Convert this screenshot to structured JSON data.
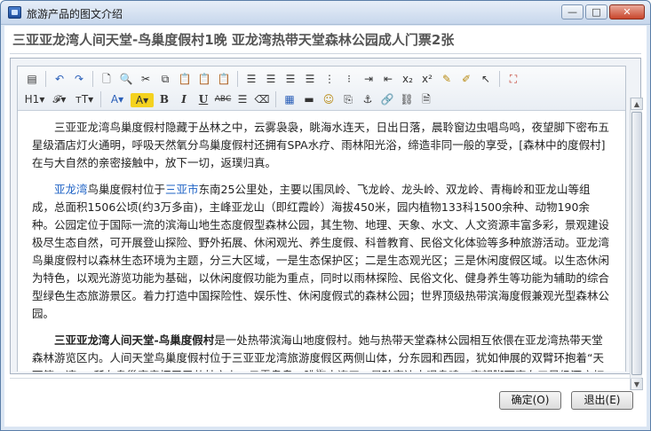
{
  "window": {
    "title": "旅游产品的图文介绍",
    "minimize_glyph": "—",
    "maximize_glyph": "□",
    "close_glyph": "✕"
  },
  "product_title": "三亚亚龙湾人间天堂-鸟巢度假村1晚 亚龙湾热带天堂森林公园成人门票2张",
  "toolbar": {
    "row1": [
      {
        "name": "source-icon",
        "glyph": "▤"
      },
      {
        "sep": true
      },
      {
        "name": "undo-icon",
        "glyph": "↶"
      },
      {
        "name": "redo-icon",
        "glyph": "↷"
      },
      {
        "sep": true
      },
      {
        "name": "new-document-icon",
        "glyph": "🗋"
      },
      {
        "name": "preview-icon",
        "glyph": "🔍"
      },
      {
        "name": "cut-icon",
        "glyph": "✂"
      },
      {
        "name": "copy-icon",
        "glyph": "⧉"
      },
      {
        "name": "paste-icon",
        "glyph": "📋"
      },
      {
        "name": "paste-text-icon",
        "glyph": "📋"
      },
      {
        "name": "paste-word-icon",
        "glyph": "📋"
      },
      {
        "sep": true
      },
      {
        "name": "align-left-icon",
        "glyph": "☰"
      },
      {
        "name": "align-center-icon",
        "glyph": "☰"
      },
      {
        "name": "align-right-icon",
        "glyph": "☰"
      },
      {
        "name": "align-justify-icon",
        "glyph": "☰"
      },
      {
        "name": "ordered-list-icon",
        "glyph": "⋮"
      },
      {
        "name": "unordered-list-icon",
        "glyph": "⁝"
      },
      {
        "name": "indent-icon",
        "glyph": "⇥"
      },
      {
        "name": "outdent-icon",
        "glyph": "⇤"
      },
      {
        "name": "subscript-icon",
        "glyph": "x₂"
      },
      {
        "name": "superscript-icon",
        "glyph": "x²"
      },
      {
        "name": "clear-format-icon",
        "glyph": "✎"
      },
      {
        "name": "format-brush-icon",
        "glyph": "✐"
      },
      {
        "name": "select-all-icon",
        "glyph": "↖"
      },
      {
        "sep": true
      },
      {
        "name": "fullscreen-icon",
        "glyph": "⛶"
      }
    ],
    "row2": [
      {
        "name": "heading-dropdown",
        "glyph": "H1▾",
        "wide": true
      },
      {
        "name": "font-family-dropdown",
        "glyph": "𝓕▾",
        "wide": true
      },
      {
        "name": "font-size-dropdown",
        "glyph": "тT▾",
        "wide": true
      },
      {
        "sep": true
      },
      {
        "name": "font-color-icon",
        "glyph": "A▾",
        "wide": true
      },
      {
        "name": "highlight-color-icon",
        "glyph": "A▾",
        "wide": true
      },
      {
        "name": "bold-icon",
        "glyph": "B"
      },
      {
        "name": "italic-icon",
        "glyph": "I"
      },
      {
        "name": "underline-icon",
        "glyph": "U"
      },
      {
        "name": "strikethrough-icon",
        "glyph": "ABC"
      },
      {
        "name": "line-height-icon",
        "glyph": "☰"
      },
      {
        "name": "remove-format-icon",
        "glyph": "⌫"
      },
      {
        "sep": true
      },
      {
        "name": "table-icon",
        "glyph": "▦"
      },
      {
        "name": "horizontal-rule-icon",
        "glyph": "▬"
      },
      {
        "name": "emoticon-icon",
        "glyph": "☺"
      },
      {
        "name": "page-break-icon",
        "glyph": "⎘"
      },
      {
        "name": "anchor-icon",
        "glyph": "⚓"
      },
      {
        "name": "link-icon",
        "glyph": "🔗"
      },
      {
        "name": "unlink-icon",
        "glyph": "⛓"
      },
      {
        "name": "file-icon",
        "glyph": "🗎"
      }
    ]
  },
  "content": {
    "p1": "三亚亚龙湾鸟巢度假村隐藏于丛林之中，云雾袅袅，眺海水连天，日出日落，晨聆窗边虫唱鸟鸣，夜望脚下密布五星级酒店灯火通明，呼吸天然氧分鸟巢度假村还拥有SPA水疗、雨林阳光浴，缔造非同一般的享受，[森林中的度假村] 在与大自然的亲密接触中，放下一切，返璞归真。",
    "p2_link1": "亚龙湾",
    "p2_a": "鸟巢度假村位于",
    "p2_link2": "三亚市",
    "p2_b": "东南25公里处，主要以围凤岭、飞龙岭、龙头岭、双龙岭、青梅岭和亚龙山等组成，总面积1506公顷(约3万多亩)，主峰亚龙山（即红霞岭）海拔450米，园内植物133科1500余种、动物190余种。公园定位于国际一流的滨海山地生态度假型森林公园，其生物、地理、天象、水文、人文资源丰富多彩，景观建设极尽生态自然，可开展登山探险、野外拓展、休闲观光、养生度假、科普教育、民俗文化体验等多种旅游活动。亚龙湾鸟巢度假村以森林生态环境为主题，分三大区域，一是生态保护区；二是生态观光区；三是休闲度假区域。以生态休闲为特色，以观光游览功能为基础，以休闲度假功能为重点，同时以雨林探险、民俗文化、健身养生等功能为辅助的综合型绿色生态旅游景区。着力打造中国探险性、娱乐性、休闲度假式的森林公园；世界顶级热带滨海度假兼观光型森林公园。",
    "p3_bold": "三亚亚龙湾人间天堂-鸟巢度假村",
    "p3": "是一处热带滨海山地度假村。她与热带天堂森林公园相互依偎在亚龙湾热带天堂森林游览区内。人间天堂鸟巢度假村位于三亚亚龙湾旅游度假区两侧山体，分东园和西园，犹如伸展的双臂环抱着“天下第一湾”。所有鸟巢客房栖居于丛林之上，云雾袅袅，眺海水连天，晨聆窗边虫唱鸟鸣，夜望脚下密布五星级酒店灯火通明，使"
  },
  "buttons": {
    "ok": "确定(O)",
    "exit": "退出(E)"
  }
}
